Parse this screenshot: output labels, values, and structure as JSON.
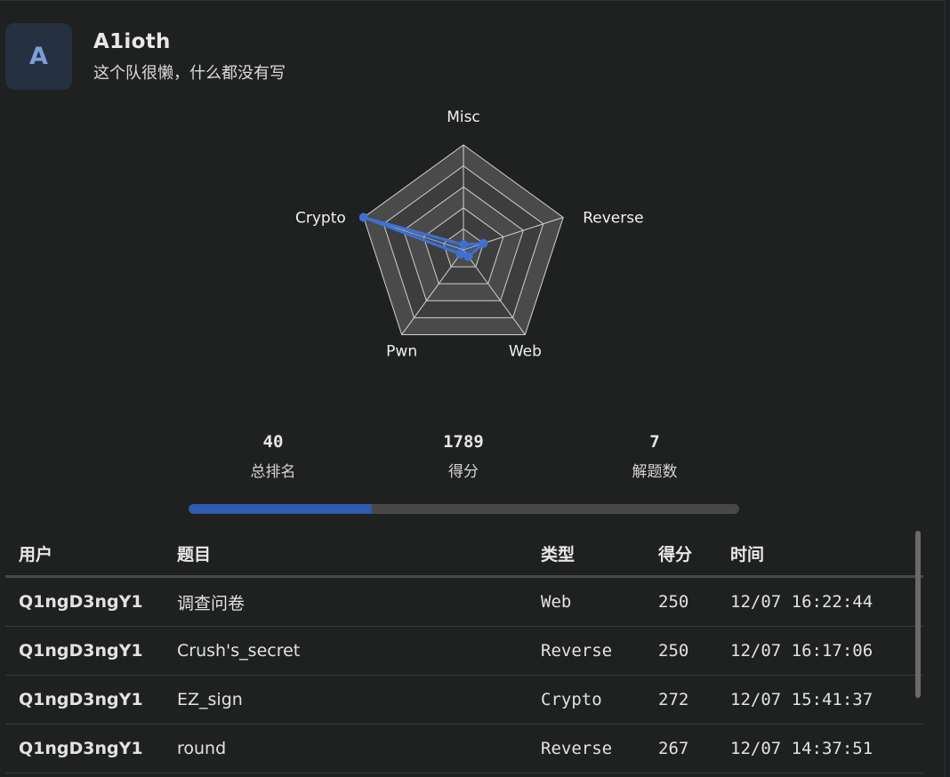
{
  "team": {
    "avatar_letter": "A",
    "name": "A1ioth",
    "bio": "这个队很懒，什么都没有写"
  },
  "chart_data": {
    "type": "radar",
    "axes": [
      "Misc",
      "Reverse",
      "Web",
      "Pwn",
      "Crypto"
    ],
    "values": [
      0.05,
      0.2,
      0.08,
      0.05,
      1.0
    ],
    "range": [
      0,
      1
    ],
    "grid_rings": 5,
    "color": "#3f6fd0"
  },
  "stats": [
    {
      "value": "40",
      "label": "总排名"
    },
    {
      "value": "1789",
      "label": "得分"
    },
    {
      "value": "7",
      "label": "解题数"
    }
  ],
  "progress": {
    "fraction": 0.333,
    "color": "#2f5bb0"
  },
  "table": {
    "headers": [
      "用户",
      "题目",
      "类型",
      "得分",
      "时间"
    ],
    "rows": [
      [
        "Q1ngD3ngY1",
        "调查问卷",
        "Web",
        "250",
        "12/07 16:22:44"
      ],
      [
        "Q1ngD3ngY1",
        "Crush's_secret",
        "Reverse",
        "250",
        "12/07 16:17:06"
      ],
      [
        "Q1ngD3ngY1",
        "EZ_sign",
        "Crypto",
        "272",
        "12/07 15:41:37"
      ],
      [
        "Q1ngD3ngY1",
        "round",
        "Reverse",
        "267",
        "12/07 14:37:51"
      ]
    ]
  }
}
